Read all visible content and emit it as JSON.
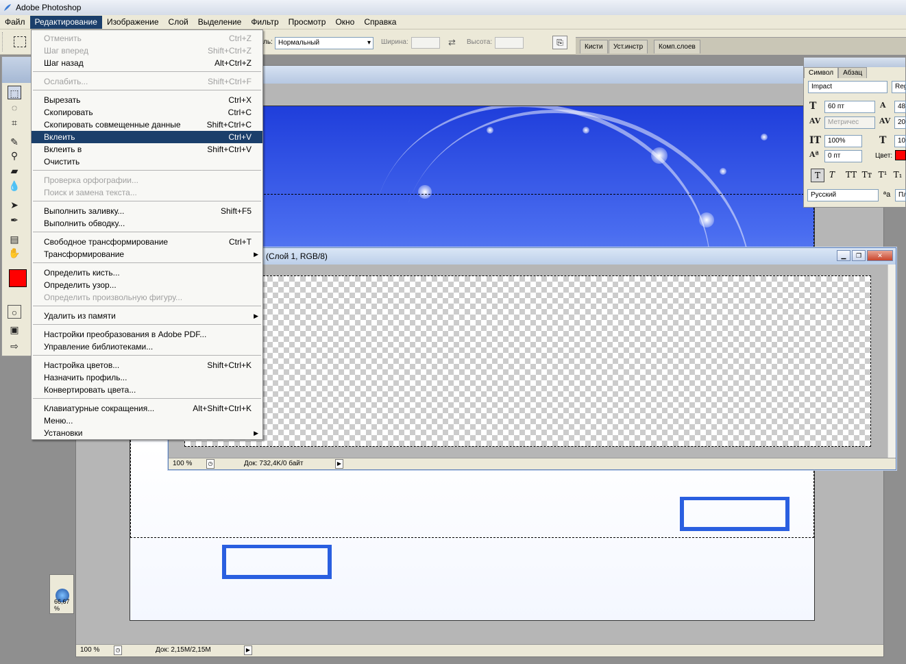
{
  "window": {
    "title": "Adobe Photoshop"
  },
  "menubar": [
    "Файл",
    "Редактирование",
    "Изображение",
    "Слой",
    "Выделение",
    "Фильтр",
    "Просмотр",
    "Окно",
    "Справка"
  ],
  "options": {
    "style_label_fragment": "ль:",
    "style_value": "Нормальный",
    "width_label": "Ширина:",
    "height_label": "Высота:",
    "tabs": [
      "Кисти",
      "Уст.инстр",
      "Комп.слоев"
    ]
  },
  "edit_menu": {
    "items": [
      {
        "label": "Отменить",
        "shortcut": "Ctrl+Z",
        "disabled": true
      },
      {
        "label": "Шаг вперед",
        "shortcut": "Shift+Ctrl+Z",
        "disabled": true
      },
      {
        "label": "Шаг назад",
        "shortcut": "Alt+Ctrl+Z"
      },
      {
        "label": "Ослабить...",
        "shortcut": "Shift+Ctrl+F",
        "disabled": true
      },
      {
        "label": "Вырезать",
        "shortcut": "Ctrl+X"
      },
      {
        "label": "Скопировать",
        "shortcut": "Ctrl+C"
      },
      {
        "label": "Скопировать совмещенные данные",
        "shortcut": "Shift+Ctrl+C"
      },
      {
        "label": "Вклеить",
        "shortcut": "Ctrl+V",
        "highlighted": true
      },
      {
        "label": "Вклеить в",
        "shortcut": "Shift+Ctrl+V"
      },
      {
        "label": "Очистить",
        "shortcut": ""
      },
      {
        "label": "Проверка орфографии...",
        "shortcut": "",
        "disabled": true
      },
      {
        "label": "Поиск и замена текста...",
        "shortcut": "",
        "disabled": true
      },
      {
        "label": "Выполнить заливку...",
        "shortcut": "Shift+F5"
      },
      {
        "label": "Выполнить обводку...",
        "shortcut": ""
      },
      {
        "label": "Свободное трансформирование",
        "shortcut": "Ctrl+T"
      },
      {
        "label": "Трансформирование",
        "shortcut": "",
        "submenu": true
      },
      {
        "label": "Определить кисть...",
        "shortcut": ""
      },
      {
        "label": "Определить узор...",
        "shortcut": ""
      },
      {
        "label": "Определить произвольную фигуру...",
        "shortcut": "",
        "disabled": true
      },
      {
        "label": "Удалить из памяти",
        "shortcut": "",
        "submenu": true
      },
      {
        "label": "Настройки преобразования в Adobe PDF...",
        "shortcut": ""
      },
      {
        "label": "Управление библиотеками...",
        "shortcut": ""
      },
      {
        "label": "Настройка цветов...",
        "shortcut": "Shift+Ctrl+K"
      },
      {
        "label": "Назначить профиль...",
        "shortcut": ""
      },
      {
        "label": "Конвертировать цвета...",
        "shortcut": ""
      },
      {
        "label": "Клавиатурные сокращения...",
        "shortcut": "Alt+Shift+Ctrl+K"
      },
      {
        "label": "Меню...",
        "shortcut": ""
      },
      {
        "label": "Установки",
        "shortcut": "",
        "submenu": true
      }
    ]
  },
  "layer_doc": {
    "title": "(Слой 1, RGB/8)",
    "zoom": "100 %",
    "doc_info": "Док: 732,4K/0 байт"
  },
  "main_doc": {
    "zoom": "100 %",
    "doc_info": "Док: 2,15M/2,15M"
  },
  "character_panel": {
    "tabs": [
      "Символ",
      "Абзац"
    ],
    "font_family": "Impact",
    "font_style": "Reg",
    "font_size": "60 пт",
    "leading": "48",
    "kerning": "Метричес",
    "tracking": "20",
    "vertical_scale": "100%",
    "horizontal_scale": "10",
    "baseline_shift": "0 пт",
    "color_label": "Цвет:",
    "color": "#ff0000",
    "language": "Русский",
    "antialias": "Пл"
  },
  "thumbnail": {
    "zoom": "66,67 %"
  },
  "colors": {
    "foreground": "#ff0000",
    "menu_highlight": "#1b3f6b"
  }
}
